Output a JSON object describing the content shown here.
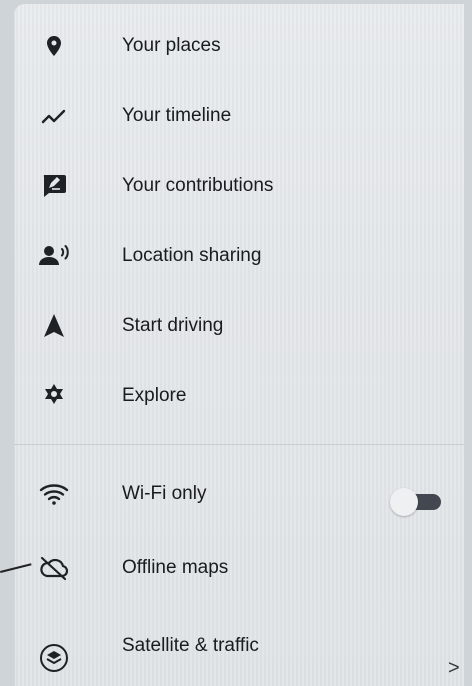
{
  "menu": {
    "items": [
      {
        "label": "Your places",
        "icon": "location-pin-icon"
      },
      {
        "label": "Your timeline",
        "icon": "timeline-icon"
      },
      {
        "label": "Your contributions",
        "icon": "contributions-icon"
      },
      {
        "label": "Location sharing",
        "icon": "location-sharing-icon"
      },
      {
        "label": "Start driving",
        "icon": "navigation-arrow-icon"
      },
      {
        "label": "Explore",
        "icon": "explore-icon"
      }
    ],
    "settings": [
      {
        "label": "Wi-Fi only",
        "icon": "wifi-icon",
        "toggle": false
      },
      {
        "label": "Offline maps",
        "icon": "cloud-off-icon"
      },
      {
        "label": "Satellite & traffic",
        "icon": "layers-icon",
        "chevron": ">"
      }
    ]
  }
}
